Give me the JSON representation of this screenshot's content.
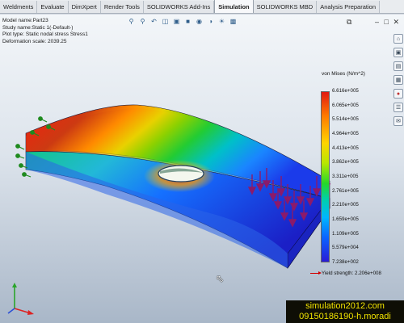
{
  "tabs": [
    "Weldments",
    "Evaluate",
    "DimXpert",
    "Render Tools",
    "SOLIDWORKS Add-Ins",
    "Simulation",
    "SOLIDWORKS MBD",
    "Analysis Preparation"
  ],
  "active_tab": "Simulation",
  "info": {
    "model_name": "Model name:Part23",
    "study_name": "Study name:Static 1(-Default-)",
    "plot_type": "Plot type: Static nodal stress Stress1",
    "deformation_scale": "Deformation scale: 2039.25"
  },
  "legend": {
    "title": "von Mises (N/m^2)",
    "ticks": [
      "6.616e+005",
      "6.065e+005",
      "5.514e+005",
      "4.964e+005",
      "4.413e+005",
      "3.862e+005",
      "3.311e+005",
      "2.761e+005",
      "2.210e+005",
      "1.659e+005",
      "1.109e+005",
      "5.579e+004",
      "7.238e+002"
    ],
    "yield_strength": "Yield strength: 2.206e+008"
  },
  "watermark": {
    "line1": "simulation2012.com",
    "line2": "09150186190-h.moradi"
  },
  "colors": {
    "max_stress": "#e11a12",
    "min_stress": "#2a1cd6",
    "load_arrows": "#8b1a6b",
    "fixture_arrows": "#1f8a1f"
  },
  "icons": {
    "view_toolbar": [
      "zoom-to-fit-icon",
      "zoom-area-icon",
      "previous-view-icon",
      "section-view-icon",
      "view-orientation-icon",
      "display-style-icon",
      "hide-show-icon",
      "edit-appearance-icon",
      "apply-scene-icon",
      "view-settings-icon"
    ],
    "task_pane": [
      "home-icon",
      "design-library-icon",
      "file-explorer-icon",
      "view-palette-icon",
      "appearances-icon",
      "custom-properties-icon",
      "forum-icon"
    ]
  }
}
